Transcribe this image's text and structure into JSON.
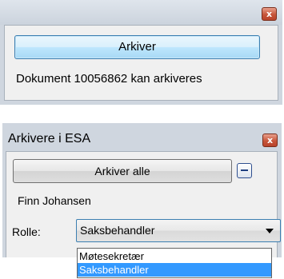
{
  "panel_top": {
    "close_glyph": "x",
    "archive_button_label": "Arkiver",
    "status_text": "Dokument 10056862 kan arkiveres"
  },
  "panel_esa": {
    "title": "Arkivere i ESA",
    "close_glyph": "x",
    "archive_all_button_label": "Arkiver alle",
    "user_name": "Finn Johansen",
    "role_label": "Rolle:",
    "role_selected": "Saksbehandler",
    "role_options": [
      "Møtesekretær",
      "Saksbehandler"
    ]
  },
  "colors": {
    "window_frame": "#cfd6df",
    "close_red": "#c7553a",
    "highlight": "#3399ff"
  }
}
